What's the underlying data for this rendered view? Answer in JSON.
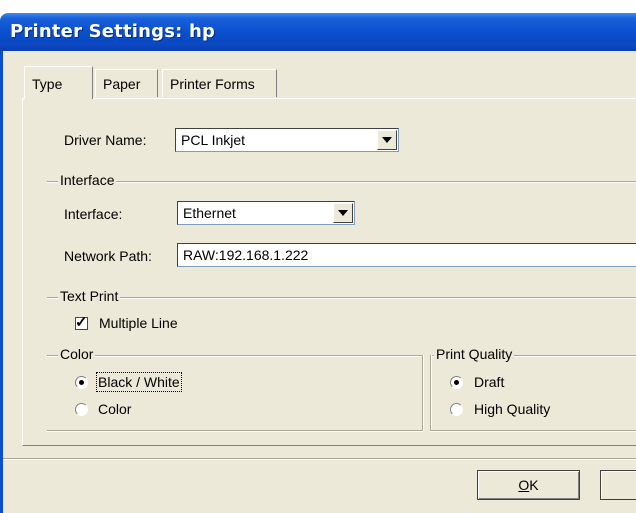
{
  "window": {
    "title": "Printer Settings: hp"
  },
  "tabs": [
    {
      "label": "Type",
      "active": true
    },
    {
      "label": "Paper",
      "active": false
    },
    {
      "label": "Printer Forms",
      "active": false
    }
  ],
  "driver": {
    "label": "Driver Name:",
    "value": "PCL Inkjet"
  },
  "interface_group": {
    "title": "Interface",
    "interface_label": "Interface:",
    "interface_value": "Ethernet",
    "network_label": "Network Path:",
    "network_value": "RAW:192.168.1.222"
  },
  "text_print": {
    "title": "Text Print",
    "multiple_line_label": "Multiple Line",
    "multiple_line_checked": true
  },
  "color_group": {
    "title": "Color",
    "options": [
      {
        "label": "Black / White",
        "selected": true
      },
      {
        "label": "Color",
        "selected": false
      }
    ]
  },
  "print_quality": {
    "title": "Print Quality",
    "options": [
      {
        "label": "Draft",
        "selected": true
      },
      {
        "label": "High Quality",
        "selected": false
      }
    ]
  },
  "buttons": {
    "ok_label": "OK"
  }
}
